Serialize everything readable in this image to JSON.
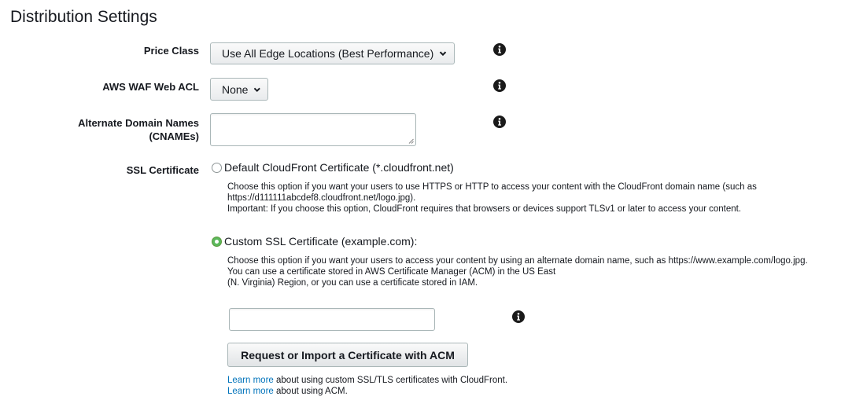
{
  "page": {
    "title": "Distribution Settings"
  },
  "price_class": {
    "label": "Price Class",
    "value": "Use All Edge Locations (Best Performance)"
  },
  "waf": {
    "label": "AWS WAF Web ACL",
    "value": "None"
  },
  "cnames": {
    "label_line1": "Alternate Domain Names",
    "label_line2": "(CNAMEs)",
    "value": ""
  },
  "ssl": {
    "label": "SSL Certificate",
    "default_option": {
      "label": "Default CloudFront Certificate (*.cloudfront.net)",
      "selected": false,
      "desc_line1": "Choose this option if you want your users to use HTTPS or HTTP to access your content with the CloudFront domain name (such as",
      "desc_line2": "https://d111111abcdef8.cloudfront.net/logo.jpg).",
      "desc_line3": "Important: If you choose this option, CloudFront requires that browsers or devices support TLSv1 or later to access your content."
    },
    "custom_option": {
      "label": "Custom SSL Certificate (example.com):",
      "selected": true,
      "desc_line1": "Choose this option if you want your users to access your content by using an alternate domain name, such as https://www.example.com/logo.jpg.",
      "desc_line2": "You can use a certificate stored in AWS Certificate Manager (ACM) in the US East",
      "desc_line3": "(N. Virginia) Region, or you can use a certificate stored in IAM."
    },
    "certificate_input": {
      "value": ""
    },
    "acm_button_label": "Request or Import a Certificate with ACM",
    "learn_more_1": {
      "link": "Learn more",
      "text": " about using custom SSL/TLS certificates with CloudFront."
    },
    "learn_more_2": {
      "link": "Learn more",
      "text": " about using ACM."
    }
  },
  "icons": {
    "info": "info-icon",
    "chevron": "chevron-down-icon"
  },
  "colors": {
    "link": "#0073bb",
    "radio_selected": "#5cb85c",
    "info_icon": "#1a1a1a"
  }
}
